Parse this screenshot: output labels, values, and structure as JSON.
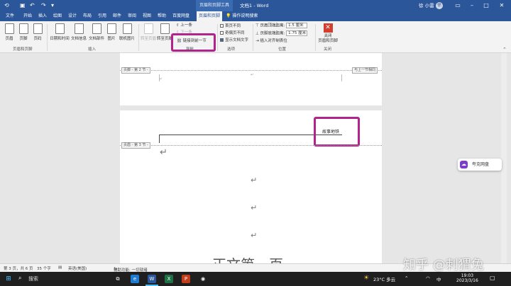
{
  "title_bar": {
    "contextual_tab": "页眉和页脚工具",
    "doc_title": "文档1 - Word",
    "user_name": "徐 小雷",
    "avatar_initial": "徐"
  },
  "tabs": [
    "文件",
    "开始",
    "插入",
    "绘图",
    "设计",
    "布局",
    "引用",
    "邮件",
    "审阅",
    "视图",
    "帮助",
    "百度网盘",
    "页眉和页脚"
  ],
  "tell_me": "操作说明搜索",
  "ribbon": {
    "hf_group": {
      "header": "页眉",
      "footer": "页脚",
      "page_number": "页码",
      "label": "页眉和页脚"
    },
    "insert_group": {
      "date_time": "日期和时间",
      "doc_info": "文档信息",
      "doc_parts": "文档部件",
      "picture": "图片",
      "online_picture": "联机图片",
      "label": "插入"
    },
    "nav_group": {
      "goto_header": "转至页眉",
      "goto_footer": "转至页脚",
      "previous": "上一条",
      "next": "下一条",
      "link_previous": "链接到前一节",
      "label": "导航"
    },
    "options_group": {
      "diff_first": "首页不同",
      "diff_odd_even": "奇偶页不同",
      "show_doc_text": "显示文档文字",
      "label": "选项"
    },
    "position_group": {
      "header_from_top": "页眉顶端距离:",
      "header_value": "1.5 厘米",
      "footer_from_bottom": "页脚底端距离:",
      "footer_value": "1.75 厘米",
      "insert_align_tab": "插入对齐制表位",
      "label": "位置"
    },
    "close_group": {
      "close_hf": "关闭\n页眉和页脚",
      "label": "关闭"
    }
  },
  "document": {
    "section2_footer_tag": "页脚 - 第 2 节 -",
    "same_as_previous": "与上一节相同",
    "section3_header_tag": "页眉 - 第 3 节 -",
    "header_text": "故事地铁",
    "body_title_partial": "正文第一页"
  },
  "side_pill": "夸克网盘",
  "status_bar": {
    "page": "第 3 页，共 6 页",
    "words": "35 个字",
    "language": "英语(美国)",
    "accessibility": "辅助功能: 一切就绪"
  },
  "taskbar": {
    "search": "搜索",
    "weather": "23°C 多云",
    "time": "19:03",
    "date": "2023/3/16",
    "ime": "中"
  },
  "watermark": "知乎 @刺猬兔"
}
